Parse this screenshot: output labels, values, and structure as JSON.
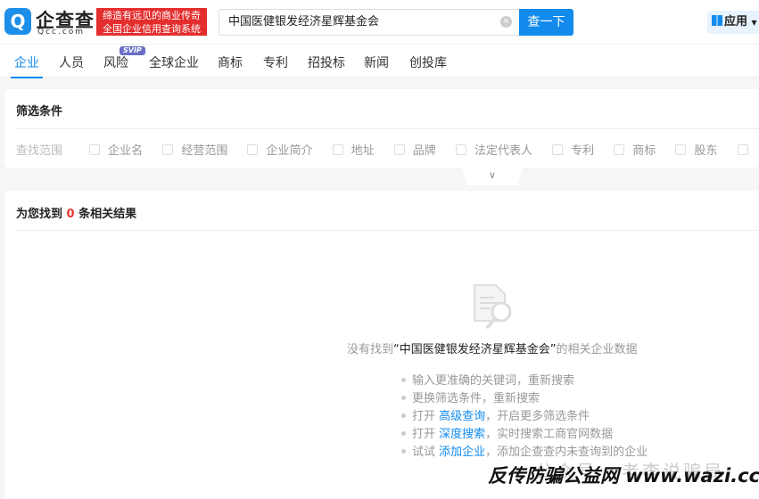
{
  "header": {
    "logo_text": "企查查",
    "logo_sub": "Qcc.com",
    "slogan_line1": "缔造有远见的商业传奇",
    "slogan_line2": "全国企业信用查询系统",
    "search_value": "中国医健银发经济星辉基金会",
    "search_button": "查一下",
    "apps_label": "应用"
  },
  "nav": {
    "tabs": [
      {
        "label": "企业",
        "active": true
      },
      {
        "label": "人员"
      },
      {
        "label": "风险",
        "badge": "SVIP"
      },
      {
        "label": "全球企业"
      },
      {
        "label": "商标"
      },
      {
        "label": "专利"
      },
      {
        "label": "招投标"
      },
      {
        "label": "新闻"
      },
      {
        "label": "创投库"
      }
    ]
  },
  "filter": {
    "title": "筛选条件",
    "scope_label": "查找范围",
    "options": [
      "企业名",
      "经营范围",
      "企业简介",
      "地址",
      "品牌",
      "法定代表人",
      "专利",
      "商标",
      "股东"
    ]
  },
  "results": {
    "prefix": "为您找到",
    "count": "0",
    "suffix": "条相关结果",
    "empty_pre": "没有找到",
    "empty_query": "“中国医健银发经济星辉基金会”",
    "empty_post": "的相关企业数据",
    "tips": [
      {
        "text": "输入更准确的关键词，重新搜索"
      },
      {
        "text": "更换筛选条件，重新搜索"
      },
      {
        "pre": "打开 ",
        "link": "高级查询",
        "post": "，开启更多筛选条件"
      },
      {
        "pre": "打开 ",
        "link": "深度搜索",
        "post": "，实时搜索工商官网数据"
      },
      {
        "pre": "试试 ",
        "link": "添加企业",
        "post": "，添加企查查内未查询到的企业"
      }
    ]
  },
  "watermark": {
    "faint": "公众号 · 老李说骗局",
    "main": "反传防骗公益网 www.wazi.cc"
  },
  "colors": {
    "accent": "#128bed",
    "slogan_bg": "#e42e2e",
    "count": "#e53935"
  }
}
